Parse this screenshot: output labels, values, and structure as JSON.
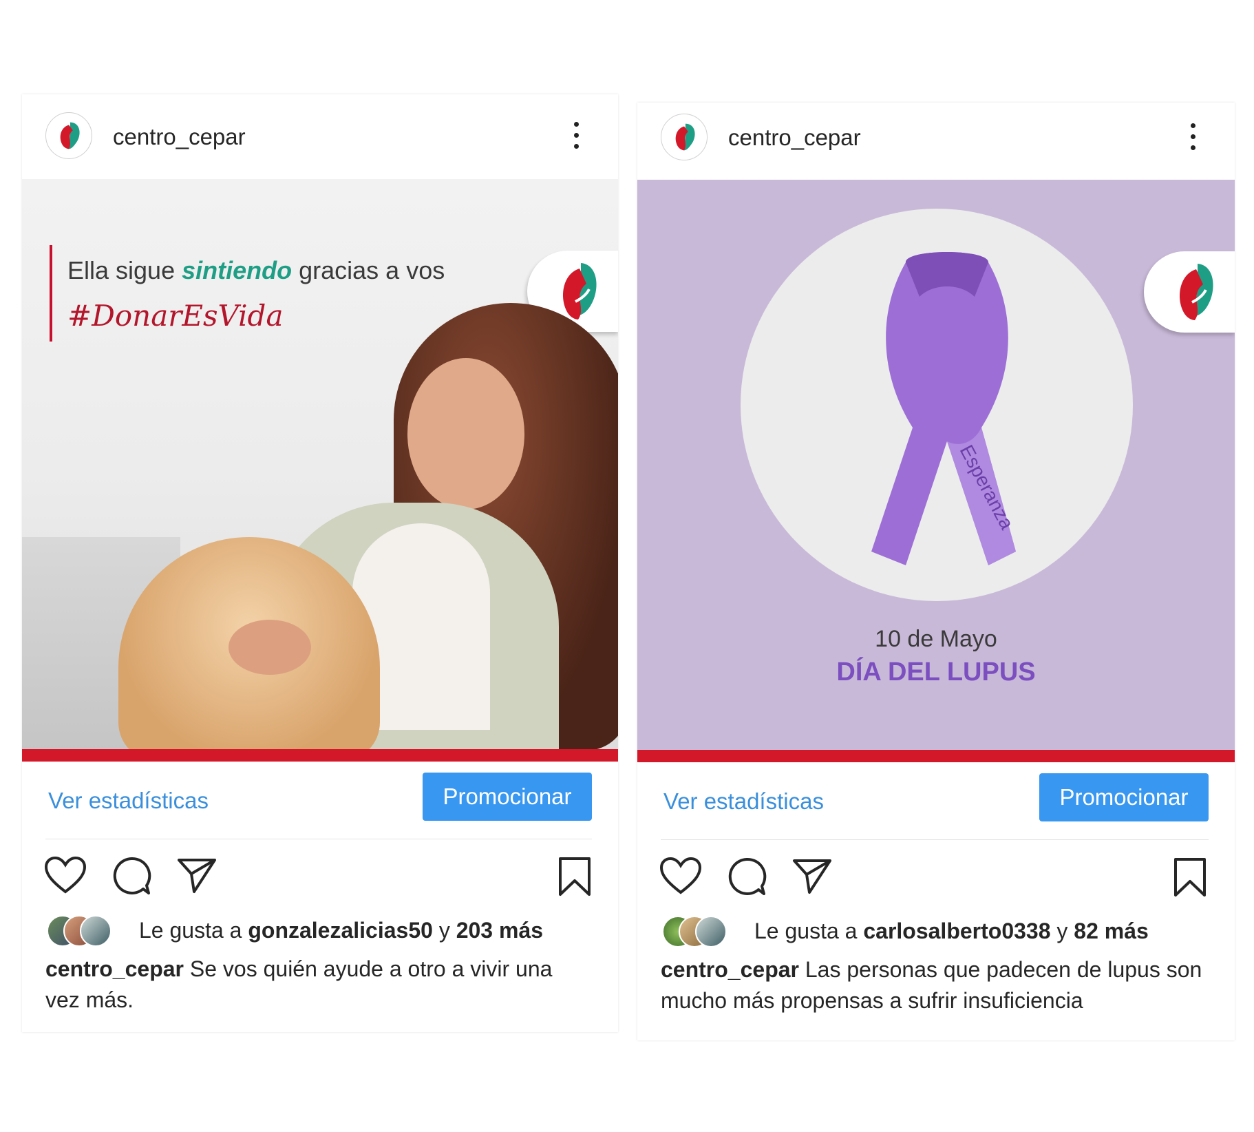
{
  "posts": [
    {
      "username": "centro_cepar",
      "image": {
        "headline_part1": "Ella sigue ",
        "headline_highlight": "sintiendo",
        "headline_part2": " gracias a vos",
        "hashtag": "#DonarEsVida"
      },
      "ver_estadisticas": "Ver estadísticas",
      "promocionar": "Promocionar",
      "likes_prefix": "Le gusta a ",
      "likes_user": "gonzalezalicias50",
      "likes_mid": " y ",
      "likes_count": "203 más",
      "caption_user": "centro_cepar",
      "caption_text": " Se vos quién ayude a otro a vivir una vez más."
    },
    {
      "username": "centro_cepar",
      "image": {
        "ribbon_text": "Esperanza",
        "date": "10 de Mayo",
        "title": "DÍA DEL LUPUS"
      },
      "ver_estadisticas": "Ver estadísticas",
      "promocionar": "Promocionar",
      "likes_prefix": "Le gusta a ",
      "likes_user": "carlosalberto0338",
      "likes_mid": " y ",
      "likes_count": "82 más",
      "caption_user": "centro_cepar",
      "caption_text": " Las personas que padecen de lupus son mucho más propensas a sufrir insuficiencia"
    }
  ],
  "colors": {
    "brand_red": "#d3182a",
    "brand_green": "#1f9e86",
    "promo_blue": "#3897f0",
    "lupus_purple": "#8a58c8",
    "lupus_bg": "#c9b9d9"
  }
}
